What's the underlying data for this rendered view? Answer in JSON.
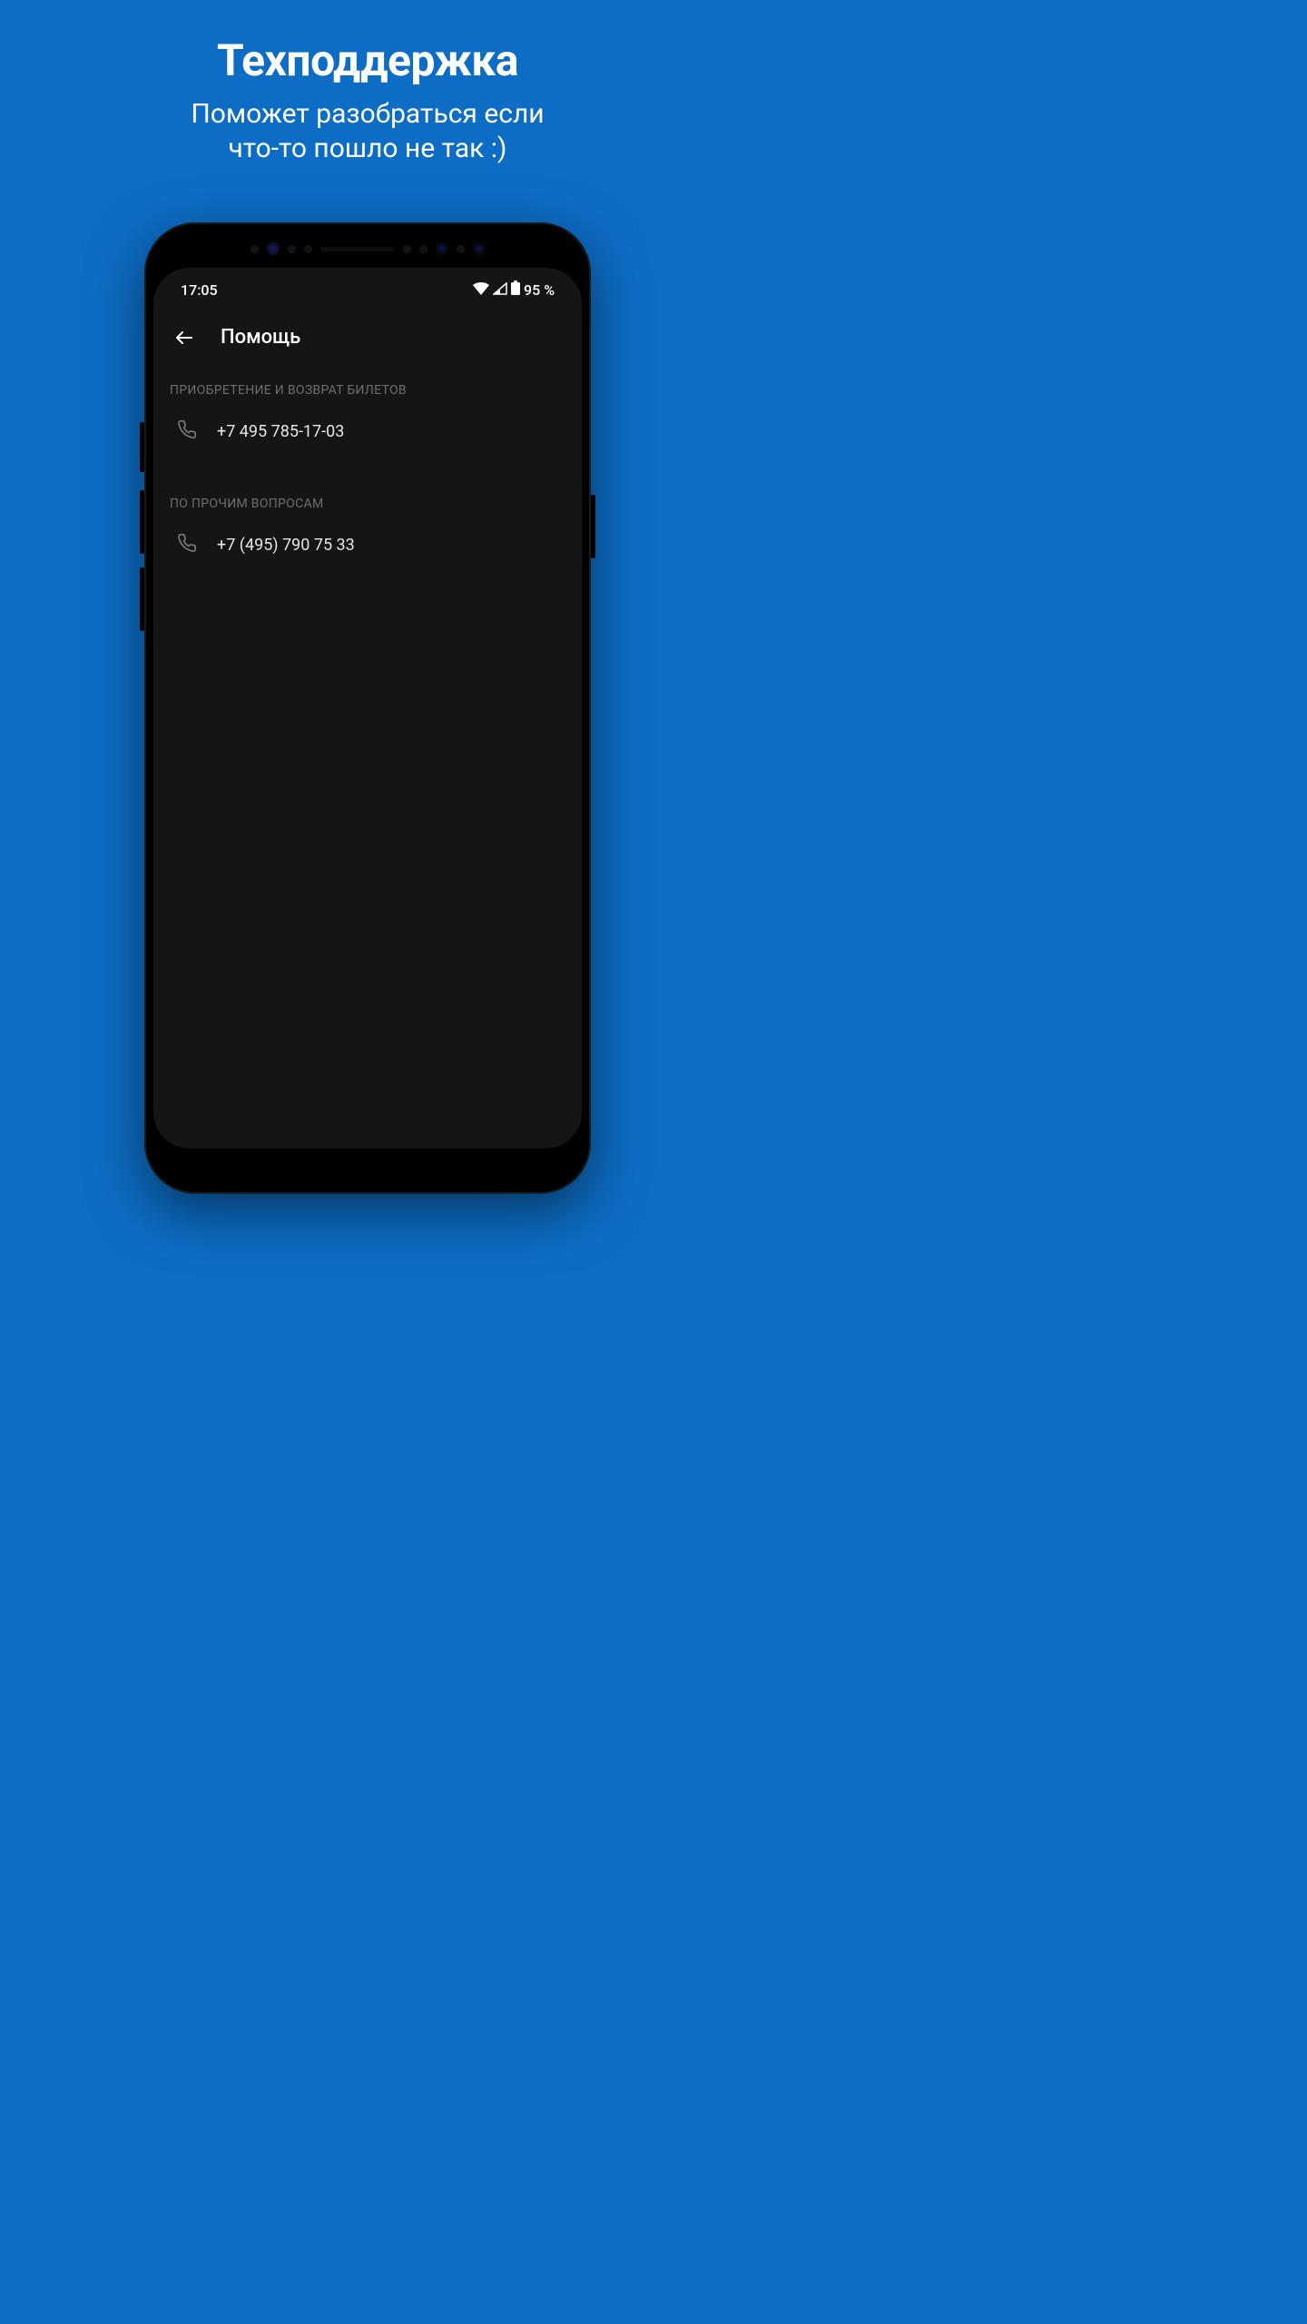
{
  "promo": {
    "title": "Техподдержка",
    "subtitle_l1": "Поможет разобраться если",
    "subtitle_l2": "что-то пошло не так :)"
  },
  "status": {
    "time": "17:05",
    "battery_text": "95 %"
  },
  "appbar": {
    "title": "Помощь"
  },
  "sections": [
    {
      "header": "ПРИОБРЕТЕНИЕ И ВОЗВРАТ БИЛЕТОВ",
      "phone": "+7 495 785-17-03"
    },
    {
      "header": "ПО ПРОЧИМ ВОПРОСАМ",
      "phone": "+7 (495) 790 75 33"
    }
  ]
}
